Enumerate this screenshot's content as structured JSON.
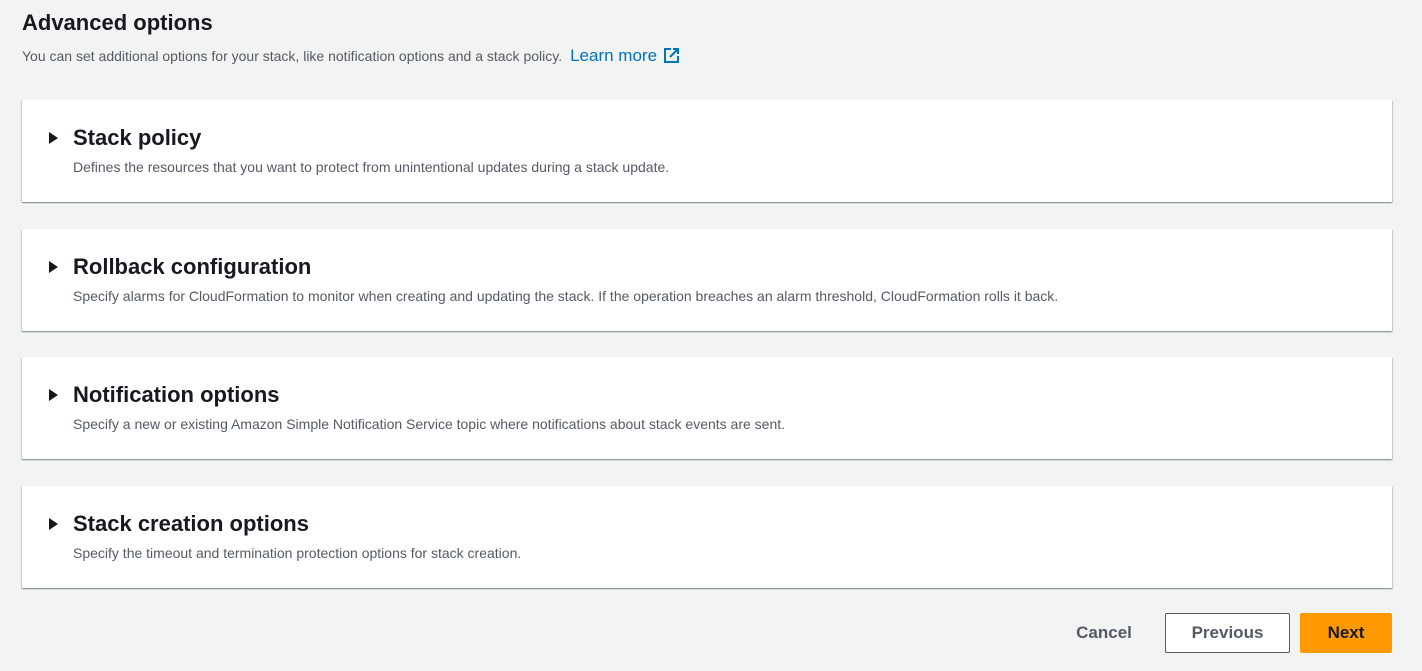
{
  "header": {
    "title": "Advanced options",
    "subtitle": "You can set additional options for your stack, like notification options and a stack policy.",
    "learn_more": "Learn more",
    "learn_more_icon": "external-link-icon"
  },
  "panels": [
    {
      "title": "Stack policy",
      "description": "Defines the resources that you want to protect from unintentional updates during a stack update.",
      "expanded": false
    },
    {
      "title": "Rollback configuration",
      "description": "Specify alarms for CloudFormation to monitor when creating and updating the stack. If the operation breaches an alarm threshold, CloudFormation rolls it back.",
      "expanded": false
    },
    {
      "title": "Notification options",
      "description": "Specify a new or existing Amazon Simple Notification Service topic where notifications about stack events are sent.",
      "expanded": false
    },
    {
      "title": "Stack creation options",
      "description": "Specify the timeout and termination protection options for stack creation.",
      "expanded": false
    }
  ],
  "actions": {
    "cancel": "Cancel",
    "previous": "Previous",
    "next": "Next"
  },
  "colors": {
    "background": "#f2f3f3",
    "link": "#0073bb",
    "primary_button": "#ff9900"
  }
}
